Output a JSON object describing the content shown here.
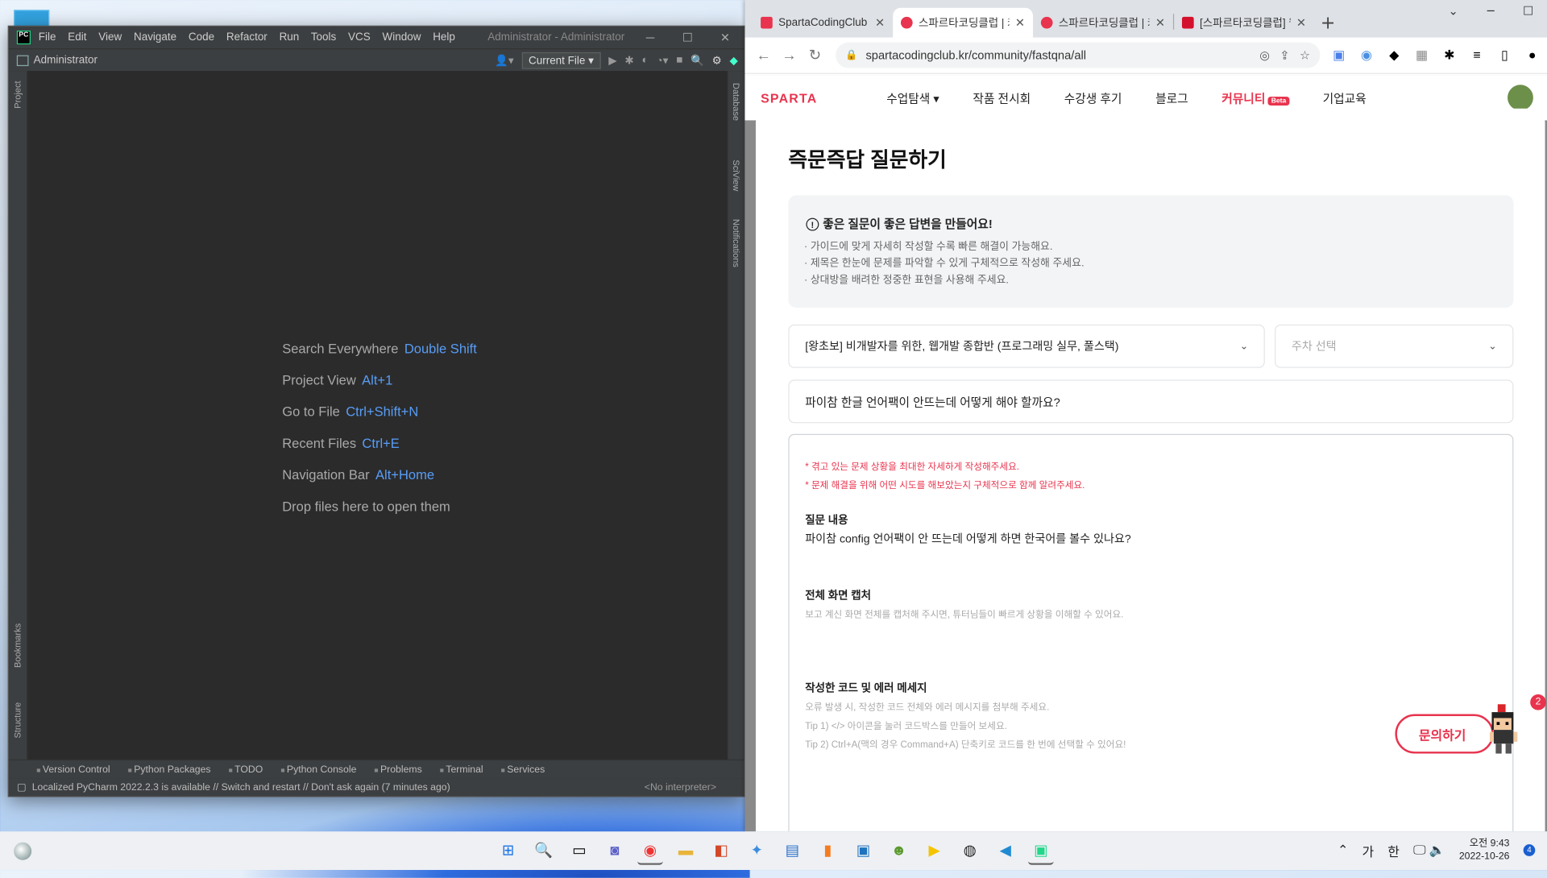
{
  "pycharm": {
    "logo_text": "PC",
    "menu": [
      "File",
      "Edit",
      "View",
      "Navigate",
      "Code",
      "Refactor",
      "Run",
      "Tools",
      "VCS",
      "Window",
      "Help"
    ],
    "window_title": "Administrator - Administrator",
    "project_name": "Administrator",
    "run_config": "Current File",
    "left_tools": [
      "Project",
      "Bookmarks",
      "Structure"
    ],
    "right_tools": [
      "Database",
      "SciView",
      "Notifications"
    ],
    "hints": [
      {
        "label": "Search Everywhere",
        "key": "Double Shift"
      },
      {
        "label": "Project View",
        "key": "Alt+1"
      },
      {
        "label": "Go to File",
        "key": "Ctrl+Shift+N"
      },
      {
        "label": "Recent Files",
        "key": "Ctrl+E"
      },
      {
        "label": "Navigation Bar",
        "key": "Alt+Home"
      },
      {
        "label": "Drop files here to open them",
        "key": ""
      }
    ],
    "bottom_tools": [
      "Version Control",
      "Python Packages",
      "TODO",
      "Python Console",
      "Problems",
      "Terminal",
      "Services"
    ],
    "status_message": "Localized PyCharm 2022.2.3 is available // Switch and restart // Don't ask again (7 minutes ago)",
    "interpreter": "<No interpreter>"
  },
  "chrome": {
    "tabs": [
      {
        "title": "SpartaCodingClub",
        "color": "#e8344e"
      },
      {
        "title": "스파르타코딩클럽 | 커뮤",
        "color": "#e8344e"
      },
      {
        "title": "스파르타코딩클럽 | 커뮤",
        "color": "#e8344e"
      },
      {
        "title": "[스파르타코딩클럽] 웹",
        "color": "#d4112c"
      }
    ],
    "url": "spartacodingclub.kr/community/fastqna/all"
  },
  "site": {
    "logo": "SPARTA",
    "nav": [
      "수업탐색",
      "작품 전시회",
      "수강생 후기",
      "블로그",
      "커뮤니티",
      "기업교육"
    ],
    "beta": "Beta"
  },
  "modal": {
    "title": "즉문즉답 질문하기",
    "guide_title": "좋은 질문이 좋은 답변을 만들어요!",
    "guide_items": [
      "· 가이드에 맞게 자세히 작성할 수록 빠른 해결이 가능해요.",
      "· 제목은 한눈에 문제를 파악할 수 있게 구체적으로 작성해 주세요.",
      "· 상대방을 배려한 정중한 표현을 사용해 주세요."
    ],
    "course_select": "[왕초보] 비개발자를 위한, 웹개발 종합반 (프로그래밍 실무, 풀스택)",
    "week_placeholder": "주차 선택",
    "question_title": "파이참 한글 언어팩이 안뜨는데 어떻게 해야 할까요?",
    "notice_1": "* 겪고 있는 문제 상황을 최대한 자세하게 작성해주세요.",
    "notice_2": "* 문제 해결을 위해 어떤 시도를 해보았는지 구체적으로 함께 알려주세요.",
    "content_heading": "질문 내용",
    "content_body": "파이참  config 언어팩이 안 뜨는데 어떻게 하면 한국어를 볼수 있나요?",
    "capture_heading": "전체 화면 캡처",
    "capture_hint": "보고 계신 화면 전체를 캡처해 주시면, 튜터님들이 빠르게 상황을 이해할 수 있어요.",
    "code_heading": "작성한 코드 및 에러 메세지",
    "code_hint_1": "오류 발생 시, 작성한 코드 전체와 에러 메시지를 첨부해 주세요.",
    "code_hint_2": "Tip 1) </> 아이콘을 눌러 코드박스를 만들어 보세요.",
    "code_hint_3": "Tip 2) Ctrl+A(맥의 경우 Command+A) 단축키로 코드를 한 번에 선택할 수 있어요!",
    "ask_button": "문의하기",
    "badge_count": "2"
  },
  "taskbar": {
    "apps": [
      "windows-start",
      "search",
      "task-view",
      "teams-chat",
      "chrome",
      "file-explorer",
      "powerpoint",
      "app-blue",
      "notepad",
      "app-orange",
      "app-kakao",
      "app-frog",
      "potplayer",
      "obs",
      "vscode",
      "pycharm"
    ],
    "ime_1": "가",
    "ime_2": "한",
    "time": "오전 9:43",
    "date": "2022-10-26",
    "notifications": "4"
  }
}
